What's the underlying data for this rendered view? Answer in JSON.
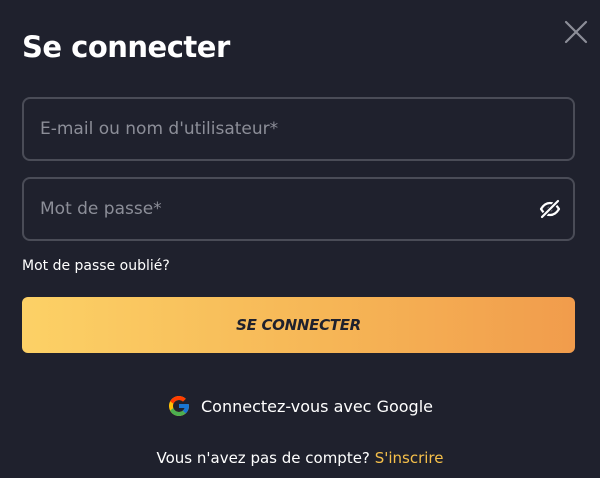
{
  "modal": {
    "title": "Se connecter"
  },
  "form": {
    "email_placeholder": "E-mail ou nom d'utilisateur*",
    "email_value": "",
    "password_placeholder": "Mot de passe*",
    "password_value": "",
    "forgot_label": "Mot de passe oublié?",
    "submit_label": "SE CONNECTER"
  },
  "google": {
    "label": "Connectez-vous avec Google"
  },
  "signup": {
    "question": "Vous n'avez pas de compte?",
    "link_label": "S'inscrire"
  },
  "icons": {
    "close": "close-icon",
    "password_toggle": "eye-off-icon",
    "google": "google-icon"
  },
  "colors": {
    "background": "#1f212d",
    "field_border": "#4a4c57",
    "button_gradient_start": "#fcd166",
    "button_gradient_end": "#f19c4c",
    "link": "#f6c04a"
  }
}
